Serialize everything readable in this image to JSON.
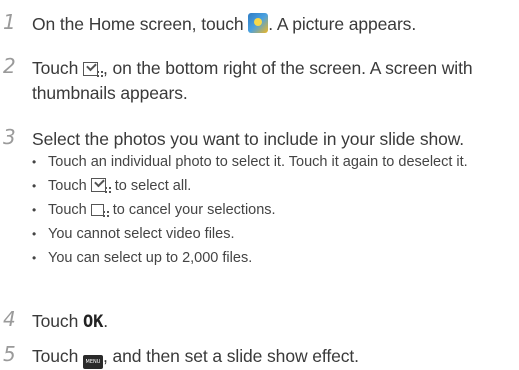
{
  "steps": [
    {
      "num": "1",
      "before": "On the Home screen, touch ",
      "icon": "gallery-app-icon",
      "after": ". A picture appears."
    },
    {
      "num": "2",
      "before": "Touch ",
      "icon": "select-multiple-icon",
      "after": ", on the bottom right of the screen. A screen with thumbnails appears."
    },
    {
      "num": "3",
      "text": "Select the photos you want to include in your slide show."
    },
    {
      "num": "4",
      "before": "Touch ",
      "ok": "OK",
      "after": "."
    },
    {
      "num": "5",
      "before": "Touch ",
      "menu": "MENU",
      "after": ", and then set a slide show effect."
    }
  ],
  "bullets": [
    {
      "text": "Touch an individual photo to select it. Touch it again to deselect it."
    },
    {
      "before": "Touch ",
      "icon": "select-all-icon",
      "after": " to select all."
    },
    {
      "before": "Touch ",
      "icon": "deselect-all-icon",
      "after": " to cancel your selections."
    },
    {
      "text": "You cannot select video files."
    },
    {
      "text": "You can select up to 2,000 files."
    }
  ]
}
